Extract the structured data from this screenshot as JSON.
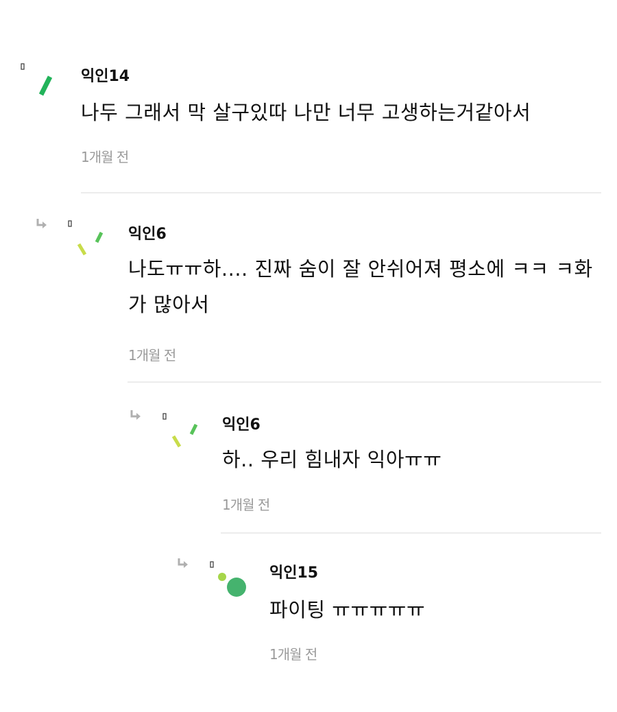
{
  "comments": [
    {
      "author": "익인14",
      "text": "나두 그래서 막 살구있따 나만 너무 고생하는거같아서",
      "time": "1개월 전",
      "avatar_icon": "green-slash-avatar-icon",
      "is_reply": false
    },
    {
      "author": "익인6",
      "text": "나도ㅠㅠ하.... 진짜 숨이 잘 안쉬어져 평소에 ㅋㅋ ㅋ화가 많아서",
      "time": "1개월 전",
      "avatar_icon": "yellow-green-dashes-avatar-icon",
      "is_reply": true
    },
    {
      "author": "익인6",
      "text": "하.. 우리 힘내자 익아ㅠㅠ",
      "time": "1개월 전",
      "avatar_icon": "yellow-green-dashes-avatar-icon",
      "is_reply": true
    },
    {
      "author": "익인15",
      "text": "파이팅 ㅠㅠㅠㅠㅠ",
      "time": "1개월 전",
      "avatar_icon": "green-dots-avatar-icon",
      "is_reply": true
    }
  ],
  "colors": {
    "accent_green": "#22b35a",
    "light_green": "#58c35a",
    "yellow_green": "#c8dc4a",
    "lime": "#a6d64a",
    "dot_green": "#45b36e",
    "reply_arrow": "#b0b0b0",
    "time_gray": "#9a9a9a",
    "divider": "#ececec"
  }
}
